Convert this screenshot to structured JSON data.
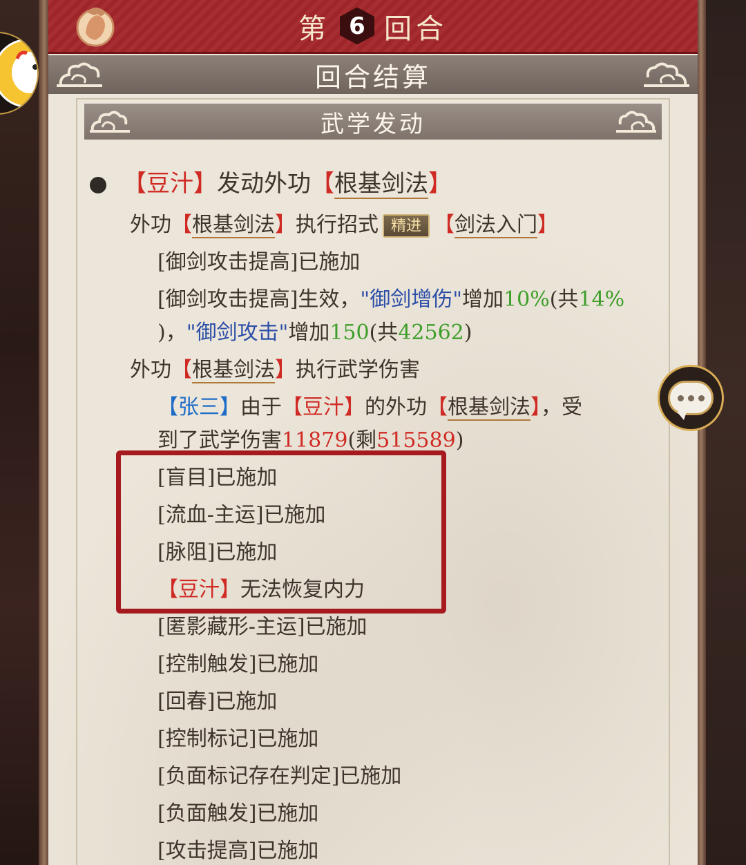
{
  "header": {
    "round_prefix": "第",
    "round_number": "6",
    "round_suffix": "回合"
  },
  "settlement_title": "回合结算",
  "section_title": "武学发动",
  "log": {
    "main": {
      "lb1": "【",
      "actor": "豆汁",
      "rb1": "】",
      "action": "发动外功",
      "lb2": "【",
      "skill": "根基剑法",
      "rb2": "】"
    },
    "exec_move": {
      "prefix": "外功",
      "lb1": "【",
      "skill": "根基剑法",
      "rb1": "】",
      "verb": "执行招式",
      "badge": "精进",
      "lb2": "【",
      "move": "剑法入门",
      "rb2": "】"
    },
    "buff_applied": "[御剑攻击提高]已施加",
    "buff_effect_1": {
      "pre": "[御剑攻击提高]生效，",
      "stat1": "\"御剑增伤\"",
      "inc1": "增加",
      "val1": "10%",
      "mid1": "(共",
      "total1": "14%"
    },
    "buff_effect_2": {
      "pre": ")，",
      "stat2": "\"御剑攻击\"",
      "inc2": "增加",
      "val2": "150",
      "mid2": "(共",
      "total2": "42562",
      "close": ")"
    },
    "exec_damage": {
      "prefix": "外功",
      "lb": "【",
      "skill": "根基剑法",
      "rb": "】",
      "verb": "执行武学伤害"
    },
    "damage_1": {
      "lb1": "【",
      "target": "张三",
      "rb1": "】",
      "because": "由于",
      "lb2": "【",
      "attacker": "豆汁",
      "rb2": "】",
      "of": "的外功",
      "lb3": "【",
      "skill": "根基剑法",
      "rb3": "】",
      "tail": "，受"
    },
    "damage_2": {
      "pre": "到了武学伤害",
      "amount": "11879",
      "mid": "(剩",
      "remain": "515589",
      "close": ")"
    },
    "highlighted": [
      {
        "text": "[盲目]已施加"
      },
      {
        "text": "[流血-主运]已施加"
      },
      {
        "text": "[脉阻]已施加"
      }
    ],
    "no_recover": {
      "lb": "【",
      "actor": "豆汁",
      "rb": "】",
      "text": "无法恢复内力"
    },
    "rest": [
      "[匿影藏形-主运]已施加",
      "[控制触发]已施加",
      "[回春]已施加",
      "[控制标记]已施加",
      "[负面标记存在判定]已施加",
      "[负面触发]已施加",
      "[攻击提高]已施加"
    ]
  },
  "colors": {
    "banner_red": "#a3262a",
    "actor_red": "#d02a24",
    "target_blue": "#1e6cc8",
    "value_green": "#3d9e2a",
    "stat_navy": "#2d4fa8",
    "highlight_box": "#a5191f"
  },
  "icons": {
    "round_icon": "character-portrait-icon",
    "avatar": "avatar-icon",
    "chat": "chat-bubble-icon"
  }
}
